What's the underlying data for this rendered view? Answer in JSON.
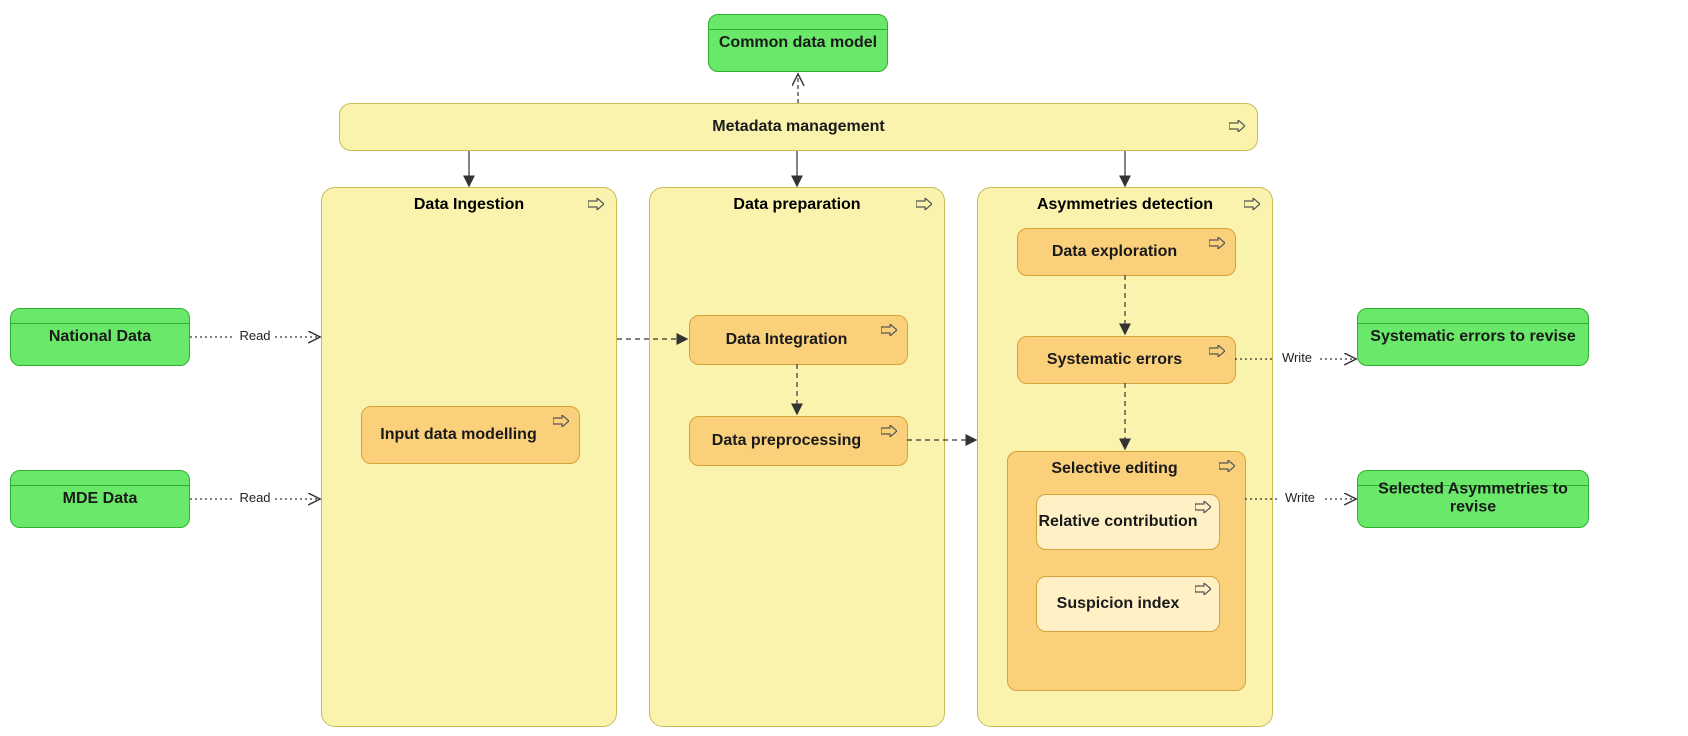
{
  "nodes": {
    "common_data_model": "Common data model",
    "metadata_management": "Metadata management",
    "national_data": "National Data",
    "mde_data": "MDE Data",
    "data_ingestion": "Data Ingestion",
    "input_data_modelling": "Input data modelling",
    "data_preparation": "Data preparation",
    "data_integration": "Data Integration",
    "data_preprocessing": "Data preprocessing",
    "asymmetries_detection": "Asymmetries detection",
    "data_exploration": "Data exploration",
    "systematic_errors": "Systematic errors",
    "selective_editing": "Selective editing",
    "relative_contribution": "Relative contribution",
    "suspicion_index": "Suspicion index",
    "systematic_errors_to_revise": "Systematic errors to revise",
    "selected_asymmetries_to_revise": "Selected Asymmetries to revise"
  },
  "edges": {
    "read": "Read",
    "write": "Write"
  },
  "icon_names": {
    "link_arrow": "link-arrow-icon"
  }
}
